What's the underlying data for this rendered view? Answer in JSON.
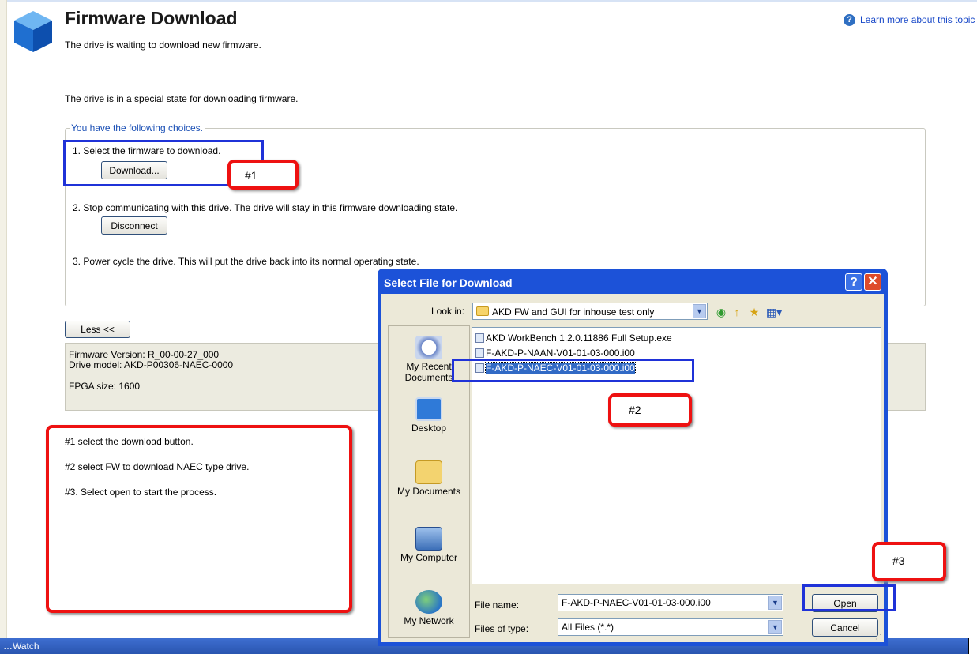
{
  "page": {
    "title": "Firmware Download",
    "subtitle": "The drive is waiting to download new firmware.",
    "help_link": "Learn more about this topic",
    "state_text": "The drive is in a special state for downloading firmware.",
    "choices_legend": "You have the following choices."
  },
  "choices": {
    "c1_text": "1. Select the firmware to download.",
    "c1_button": "Download...",
    "c2_text": "2. Stop communicating with this drive.  The drive will stay in this firmware downloading state.",
    "c2_button": "Disconnect",
    "c3_text": "3. Power cycle the drive.  This will put the drive back into its normal operating state."
  },
  "less_button": "Less <<",
  "info": {
    "firmware_version": "Firmware Version: R_00-00-27_000",
    "drive_model": "Drive model: AKD-P00306-NAEC-0000",
    "fpga_size": "FPGA size: 1600"
  },
  "annotations": {
    "tag1": "#1",
    "tag2": "#2",
    "tag3": "#3",
    "note1": "#1  select the download button.",
    "note2": "#2 select FW to download  NAEC type drive.",
    "note3": "#3. Select open to start the process."
  },
  "dialog": {
    "title": "Select File for Download",
    "help_glyph": "?",
    "close_glyph": "✕",
    "look_in_label": "Look in:",
    "look_in_value": "AKD FW and GUI for inhouse test only",
    "places": [
      "My Recent Documents",
      "Desktop",
      "My Documents",
      "My Computer",
      "My Network"
    ],
    "files": [
      "AKD WorkBench 1.2.0.11886 Full Setup.exe",
      "F-AKD-P-NAAN-V01-01-03-000.i00",
      "F-AKD-P-NAEC-V01-01-03-000.i00"
    ],
    "selected_file_index": 2,
    "file_name_label": "File name:",
    "file_name_value": "F-AKD-P-NAEC-V01-01-03-000.i00",
    "file_type_label": "Files of type:",
    "file_type_value": "All Files (*.*)",
    "open_button": "Open",
    "cancel_button": "Cancel"
  },
  "taskbar": {
    "label": "Watch"
  },
  "colors": {
    "annotation_red": "#ee1111",
    "annotation_blue": "#1f32d8",
    "dialog_titlebar": "#1c52d8"
  },
  "icons": [
    "cube-logo-icon",
    "help-icon",
    "folder-icon",
    "back-icon",
    "up-folder-icon",
    "new-folder-icon",
    "views-icon",
    "recent-documents-icon",
    "desktop-icon",
    "my-documents-icon",
    "my-computer-icon",
    "my-network-icon",
    "file-icon",
    "watch-icon"
  ]
}
